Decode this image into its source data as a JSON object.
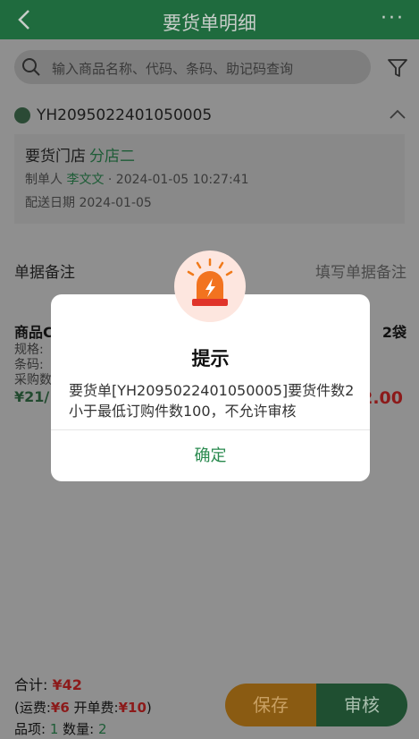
{
  "header": {
    "title": "要货单明细",
    "more": "···"
  },
  "search": {
    "placeholder": "输入商品名称、代码、条码、助记码查询"
  },
  "order": {
    "number": "YH2095022401050005",
    "store_label": "要货门店",
    "store_name": "分店二",
    "creator_label": "制单人",
    "creator_name": "李文文",
    "created_at": " · 2024-01-05 10:27:41",
    "delivery_label": "配送日期",
    "delivery_date": "2024-01-05"
  },
  "remark": {
    "label": "单据备注",
    "hint": "填写单据备注"
  },
  "product": {
    "name": "商品C",
    "qty": "2袋",
    "spec_label": "规格:",
    "barcode_label": "条码:",
    "purchase_label": "采购数",
    "price": "¥21/",
    "amount": "2.00"
  },
  "footer": {
    "total_label": "合计:",
    "total_value": "¥42",
    "fees_prefix": "(运费:",
    "freight": "¥6",
    "open_fee_label": " 开单费:",
    "open_fee": "¥10",
    "fees_suffix": ")",
    "items_label": "品项:",
    "items_value": "1",
    "qty_label": " 数量:",
    "qty_value": "2",
    "save": "保存",
    "audit": "审核"
  },
  "dialog": {
    "title": "提示",
    "message": "要货单[YH2095022401050005]要货件数2小于最低订购件数100，不允许审核",
    "confirm": "确定"
  },
  "colors": {
    "header": "#1f6b3e",
    "accent_green": "#2a8a4f",
    "price_red": "#d32f2f",
    "save_orange": "#f0a020"
  }
}
